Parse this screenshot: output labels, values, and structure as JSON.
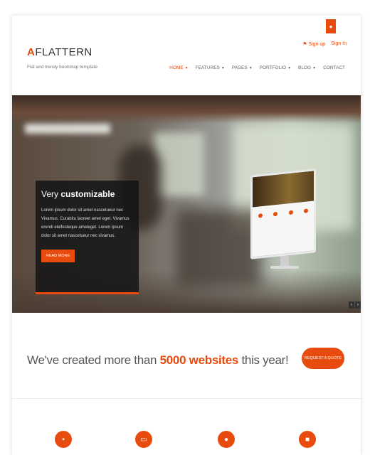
{
  "header": {
    "logo_mark": "A",
    "logo_text": "FLATTERN",
    "tagline": "Flat and trendy bootstrap template",
    "signup": "Sign up",
    "signin": "Sign In",
    "nav": [
      {
        "label": "HOME",
        "active": true
      },
      {
        "label": "FEATURES"
      },
      {
        "label": "PAGES"
      },
      {
        "label": "PORTFOLIO"
      },
      {
        "label": "BLOG"
      },
      {
        "label": "CONTACT"
      }
    ]
  },
  "hero": {
    "heading_pre": "Very ",
    "heading_bold": "customizable",
    "body": "Lorem ipsum dolor sit amet nascetueur nec Vivamus. Curabitu laoreet amet eget. Vivamus erendi eleifesteque ameleget. Lorem ipsum dolor sit amet nascetueur nec vivamus.",
    "read_more": "READ MORE"
  },
  "cta": {
    "pre": "We've created more than ",
    "highlight": "5000 websites",
    "post": " this year!",
    "button": "REQUEST A QUOTE"
  },
  "colors": {
    "accent": "#e74c0e"
  }
}
